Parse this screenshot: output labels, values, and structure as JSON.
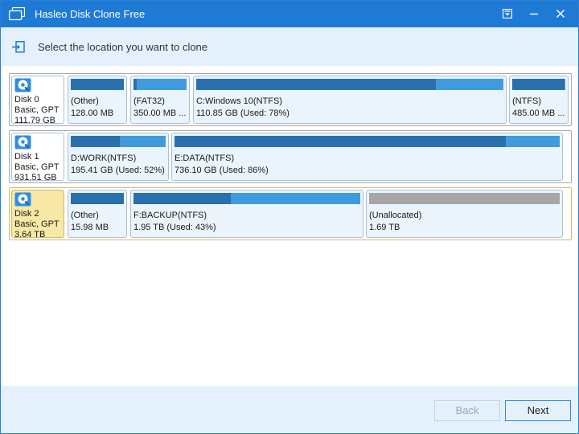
{
  "window": {
    "title": "Hasleo Disk Clone Free",
    "accent": "#1f7ad6"
  },
  "header": {
    "instruction": "Select the location you want to clone"
  },
  "disks": [
    {
      "name": "Disk 0",
      "type": "Basic, GPT",
      "size": "111.79 GB",
      "selected": false,
      "partitions": [
        {
          "name": "(Other)",
          "size": "128.00 MB",
          "used_fraction": 1.0
        },
        {
          "name": "(FAT32)",
          "size": "350.00 MB ...",
          "used_fraction": 0.06
        },
        {
          "name": "C:Windows 10(NTFS)",
          "size": "110.85 GB (Used: 78%)",
          "used_fraction": 0.78
        },
        {
          "name": "(NTFS)",
          "size": "485.00 MB ...",
          "used_fraction": 0.98
        }
      ]
    },
    {
      "name": "Disk 1",
      "type": "Basic, GPT",
      "size": "931.51 GB",
      "selected": false,
      "partitions": [
        {
          "name": "D:WORK(NTFS)",
          "size": "195.41 GB (Used: 52%)",
          "used_fraction": 0.52
        },
        {
          "name": "E:DATA(NTFS)",
          "size": "736.10 GB (Used: 86%)",
          "used_fraction": 0.86
        }
      ]
    },
    {
      "name": "Disk 2",
      "type": "Basic, GPT",
      "size": "3.64 TB",
      "selected": true,
      "partitions": [
        {
          "name": "(Other)",
          "size": "15.98 MB",
          "used_fraction": 1.0
        },
        {
          "name": "F:BACKUP(NTFS)",
          "size": "1.95 TB (Used: 43%)",
          "used_fraction": 0.43
        },
        {
          "name": "(Unallocated)",
          "size": "1.69 TB",
          "used_fraction": 0,
          "unallocated": true
        }
      ]
    }
  ],
  "footer": {
    "back_label": "Back",
    "next_label": "Next",
    "back_enabled": false
  }
}
